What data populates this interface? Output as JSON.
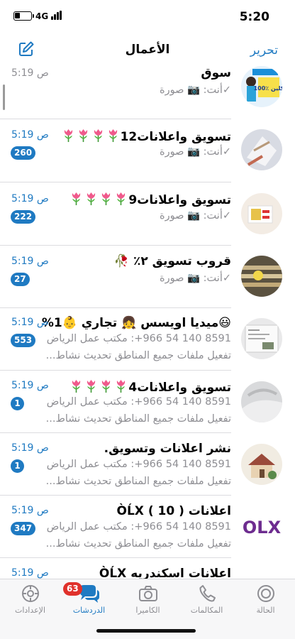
{
  "status": {
    "network": "4G",
    "time": "5:20",
    "battery_level": 0.35
  },
  "nav": {
    "title": "الأعمال",
    "edit": "تحرير"
  },
  "chats": [
    {
      "title": "سوق",
      "flowers": 0,
      "time": "5:19 ص",
      "time_read": true,
      "sub1": "✓أنت: 📷 صورة",
      "badge": ""
    },
    {
      "title": "تسويق واعلانات12",
      "flowers": 4,
      "time": "5:19 ص",
      "time_read": false,
      "sub1": "✓أنت: 📷 صورة",
      "badge": "260"
    },
    {
      "title": "تسويق واعلانات9",
      "flowers": 4,
      "time": "5:19 ص",
      "time_read": false,
      "sub1": "✓أنت: 📷 صورة",
      "badge": "222"
    },
    {
      "title": "قروب تسويق ٢٪ 🥀",
      "flowers": 0,
      "time": "5:19 ص",
      "time_read": false,
      "sub1": "✓أنت: 📷 صورة",
      "badge": "27"
    },
    {
      "title": "😃ميديا اويسس 👧 تجاري 👶1%",
      "flowers": 0,
      "time": "5:19 ص",
      "time_read": false,
      "sub1": "8591 140 54 966+: مكتب عمل الرياض",
      "sub2": "تفعيل ملفات جميع المناطق    تحديث نشاط...",
      "badge": "553"
    },
    {
      "title": "تسويق واعلانات4",
      "flowers": 4,
      "time": "5:19 ص",
      "time_read": false,
      "sub1": "8591 140 54 966+: مكتب عمل الرياض",
      "sub2": "تفعيل ملفات جميع المناطق    تحديث نشاط...",
      "badge": "1"
    },
    {
      "title": "نشر اعلانات وتسويق.",
      "flowers": 0,
      "time": "5:19 ص",
      "time_read": false,
      "sub1": "8591 140 54 966+: مكتب عمل الرياض",
      "sub2": "تفعيل ملفات جميع المناطق    تحديث نشاط...",
      "badge": "1"
    },
    {
      "title": "اعلانات   (  10  )  ÒĹX",
      "flowers": 0,
      "time": "5:19 ص",
      "time_read": false,
      "sub1": "8591 140 54 966+: مكتب عمل الرياض",
      "sub2": "تفعيل ملفات جميع المناطق    تحديث نشاط...",
      "badge": "347"
    },
    {
      "title": "اعلانات اسكندريه    ÒĹX",
      "flowers": 0,
      "time": "5:19 ص",
      "time_read": false,
      "sub1": "",
      "badge": ""
    }
  ],
  "avatar_text": {
    "promo_top": "100٪ كلين",
    "olx": "OLX"
  },
  "tabs": {
    "status": "الحالة",
    "calls": "المكالمات",
    "camera": "الكاميرا",
    "chats": "الدردشات",
    "chats_badge": "63",
    "settings": "الإعدادات"
  },
  "colors": {
    "accent": "#1f7ac2",
    "badge_red": "#e0312b",
    "grey": "#8e8e93"
  }
}
